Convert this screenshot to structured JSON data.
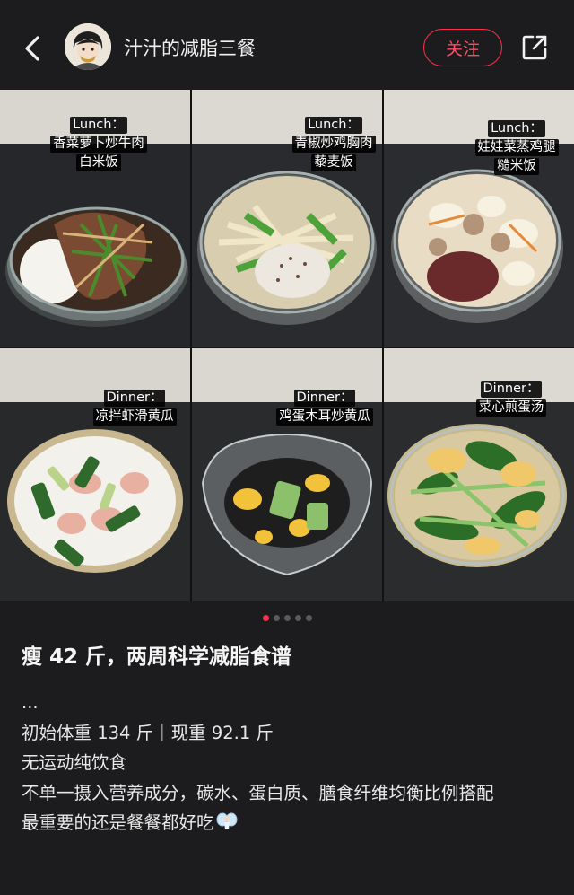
{
  "header": {
    "author_name": "汁汁的减脂三餐",
    "follow_label": "关注",
    "icons": {
      "back": "chevron-left-icon",
      "share": "share-icon"
    }
  },
  "meals": [
    {
      "meal": "Lunch：",
      "dish": "香菜萝卜炒牛肉",
      "grain": "白米饭"
    },
    {
      "meal": "Lunch：",
      "dish": "青椒炒鸡胸肉",
      "grain": "藜麦饭"
    },
    {
      "meal": "Lunch：",
      "dish": "娃娃菜蒸鸡腿",
      "grain": "糙米饭"
    },
    {
      "meal": "Dinner：",
      "dish": "凉拌虾滑黄瓜"
    },
    {
      "meal": "Dinner：",
      "dish": "鸡蛋木耳炒黄瓜"
    },
    {
      "meal": "Dinner：",
      "dish": "菜心煎蛋汤"
    }
  ],
  "pager": {
    "count": 5,
    "active_index": 0
  },
  "post": {
    "title": "瘦 42 斤，两周科学减脂食谱",
    "lines": [
      "...",
      "初始体重 134 斤｜现重 92.1 斤",
      "无运动纯饮食",
      "不单一摄入营养成分，碳水、蛋白质、膳食纤维均衡比例搭配",
      "最重要的还是餐餐都好吃"
    ],
    "trailing_emoji": "fairy-icon"
  },
  "colors": {
    "accent": "#ff2e4d",
    "background": "#1c1c1e"
  }
}
